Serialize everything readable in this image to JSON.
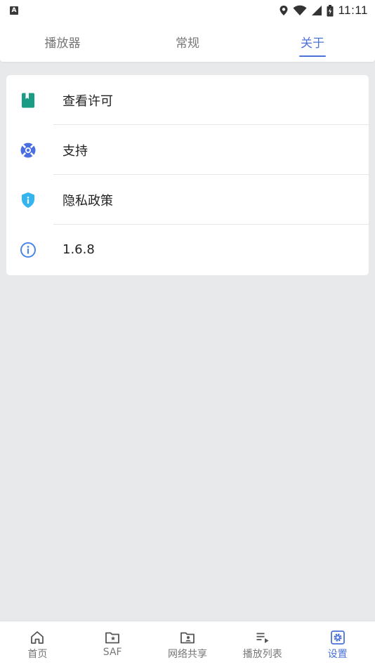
{
  "status_bar": {
    "badge": "A",
    "time": "11:11"
  },
  "top_tabs": [
    {
      "label": "播放器",
      "active": false
    },
    {
      "label": "常规",
      "active": false
    },
    {
      "label": "关于",
      "active": true
    }
  ],
  "about_items": [
    {
      "label": "查看许可",
      "icon": "book-icon",
      "color": "#1a9c84"
    },
    {
      "label": "支持",
      "icon": "lifebuoy-icon",
      "color": "#4a6fe0"
    },
    {
      "label": "隐私政策",
      "icon": "shield-icon",
      "color": "#35b5f0"
    },
    {
      "label": "1.6.8",
      "icon": "info-icon",
      "color": "#4a86e8"
    }
  ],
  "bottom_nav": [
    {
      "label": "首页",
      "icon": "home-icon",
      "active": false
    },
    {
      "label": "SAF",
      "icon": "star-folder-icon",
      "active": false
    },
    {
      "label": "网络共享",
      "icon": "network-folder-icon",
      "active": false
    },
    {
      "label": "播放列表",
      "icon": "playlist-icon",
      "active": false
    },
    {
      "label": "设置",
      "icon": "settings-icon",
      "active": true
    }
  ],
  "colors": {
    "accent": "#4a72d8",
    "background": "#e8e9eb"
  }
}
